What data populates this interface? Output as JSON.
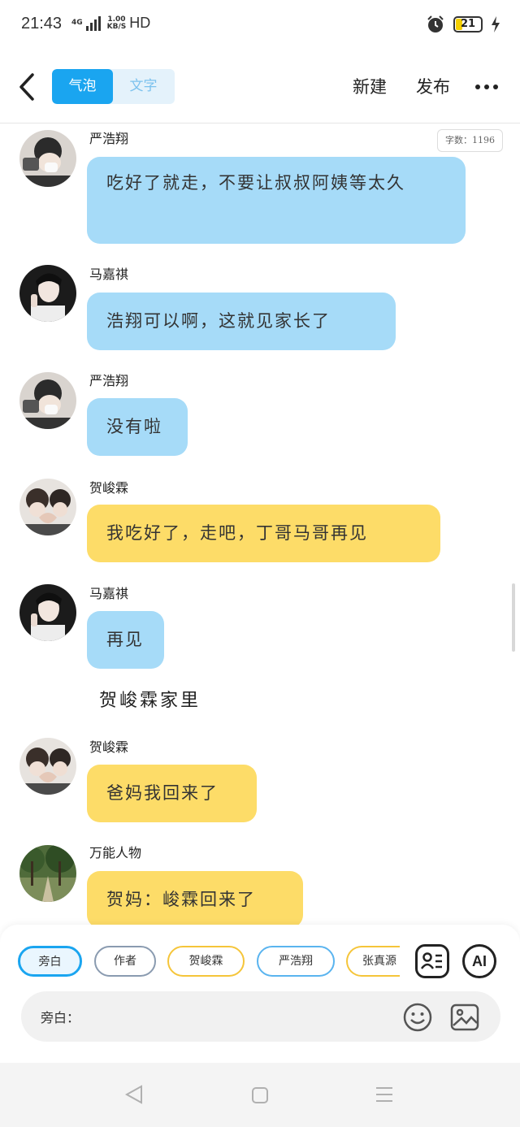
{
  "status_bar": {
    "time": "21:43",
    "network": "4G",
    "speed_value": "1.00",
    "speed_unit": "KB/S",
    "hd": "HD",
    "battery": "21"
  },
  "header": {
    "mode_bubble": "气泡",
    "mode_text": "文字",
    "new_label": "新建",
    "publish_label": "发布"
  },
  "word_count": "字数：1196",
  "messages": [
    {
      "speaker": "严浩翔",
      "text": "吃好了就走，不要让叔叔阿姨等太久",
      "color": "#a6dbf8"
    },
    {
      "speaker": "马嘉祺",
      "text": "浩翔可以啊，这就见家长了",
      "color": "#a6dbf8"
    },
    {
      "speaker": "严浩翔",
      "text": "没有啦",
      "color": "#a6dbf8"
    },
    {
      "speaker": "贺峻霖",
      "text": "我吃好了，走吧，丁哥马哥再见",
      "color": "#fddc68"
    },
    {
      "speaker": "马嘉祺",
      "text": "再见",
      "color": "#a6dbf8"
    },
    {
      "speaker": "贺峻霖",
      "text": "爸妈我回来了",
      "color": "#fddc68"
    },
    {
      "speaker": "万能人物",
      "text": "贺妈：峻霖回来了",
      "color": "#fddc68"
    }
  ],
  "aside_text": "贺峻霖家里",
  "chips": [
    {
      "label": "旁白",
      "border": "#1aa5f0"
    },
    {
      "label": "作者",
      "border": "#8a9bb0"
    },
    {
      "label": "贺峻霖",
      "border": "#f5c53a"
    },
    {
      "label": "严浩翔",
      "border": "#5ab4ef"
    },
    {
      "label": "张真源",
      "border": "#f5c53a"
    }
  ],
  "ai_label": "AI",
  "input": {
    "placeholder": "旁白："
  }
}
